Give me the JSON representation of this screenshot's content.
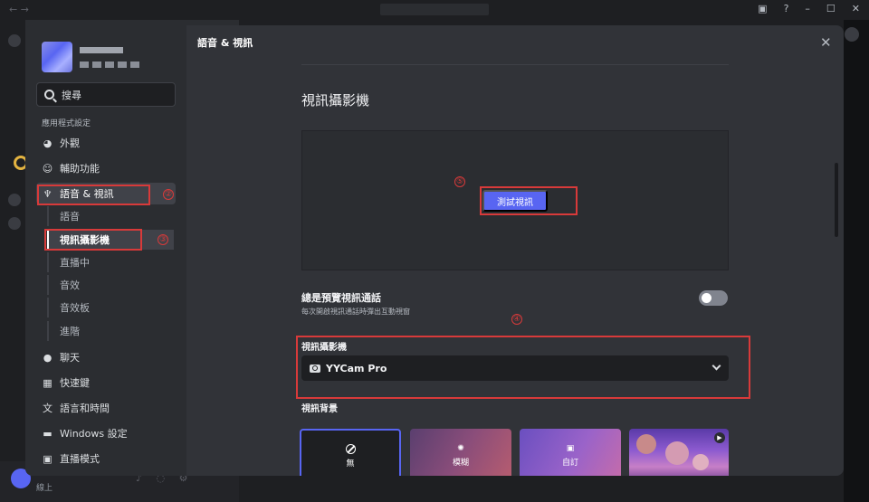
{
  "sidebar": {
    "search_placeholder": "搜尋",
    "section_header": "應用程式設定",
    "items": [
      {
        "label": "外觀",
        "icon": "palette-icon"
      },
      {
        "label": "輔助功能",
        "icon": "accessibility-icon"
      },
      {
        "label": "語音 & 視訊",
        "icon": "microphone-icon"
      }
    ],
    "sub_items": [
      "語音",
      "視訊攝影機",
      "直播中",
      "音效",
      "音效板",
      "進階"
    ],
    "lower_items": [
      {
        "label": "聊天",
        "icon": "chat-bubble-icon"
      },
      {
        "label": "快速鍵",
        "icon": "keyboard-icon"
      },
      {
        "label": "語言和時間",
        "icon": "translate-icon"
      },
      {
        "label": "Windows 設定",
        "icon": "monitor-icon"
      },
      {
        "label": "直播模式",
        "icon": "streamer-icon"
      }
    ]
  },
  "annotations": {
    "n1": "②",
    "n2": "③",
    "n3": "⑤",
    "n4": "④"
  },
  "content": {
    "header": "語音 & 視訊",
    "section_title": "視訊攝影機",
    "test_button": "測試視訊",
    "preview_pref": {
      "title": "總是預覽視訊通話",
      "description": "每次開啟視訊通話時彈出互動視窗",
      "enabled": false
    },
    "camera_label": "視訊攝影機",
    "camera_value": "YYCam Pro",
    "background_label": "視訊背景",
    "backgrounds": [
      "無",
      "模糊",
      "自訂"
    ]
  },
  "userbar": {
    "status": "線上"
  },
  "colors": {
    "accent": "#5865f2",
    "annotation": "#d83a3a"
  }
}
